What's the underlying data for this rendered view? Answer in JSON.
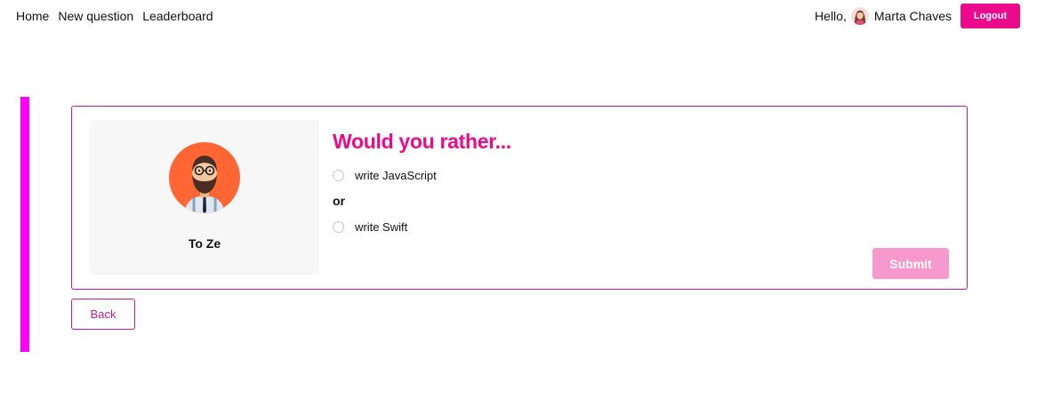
{
  "nav": {
    "items": [
      {
        "label": "Home"
      },
      {
        "label": "New question"
      },
      {
        "label": "Leaderboard"
      }
    ]
  },
  "user": {
    "greeting": "Hello,",
    "name": "Marta Chaves",
    "avatar_icon": "user-avatar-woman-icon",
    "logout_label": "Logout"
  },
  "colors": {
    "accent": "#ec0a8c",
    "accent_bar": "#ff00ff",
    "border": "#c41a96",
    "submit_disabled": "#f799cd",
    "author_avatar_bg": "#ff6633"
  },
  "question": {
    "author": {
      "name": "To Ze",
      "avatar_icon": "bearded-man-avatar-icon"
    },
    "title": "Would you rather...",
    "option_one": "write JavaScript",
    "separator": "or",
    "option_two": "write Swift",
    "submit_label": "Submit"
  },
  "back_label": "Back"
}
